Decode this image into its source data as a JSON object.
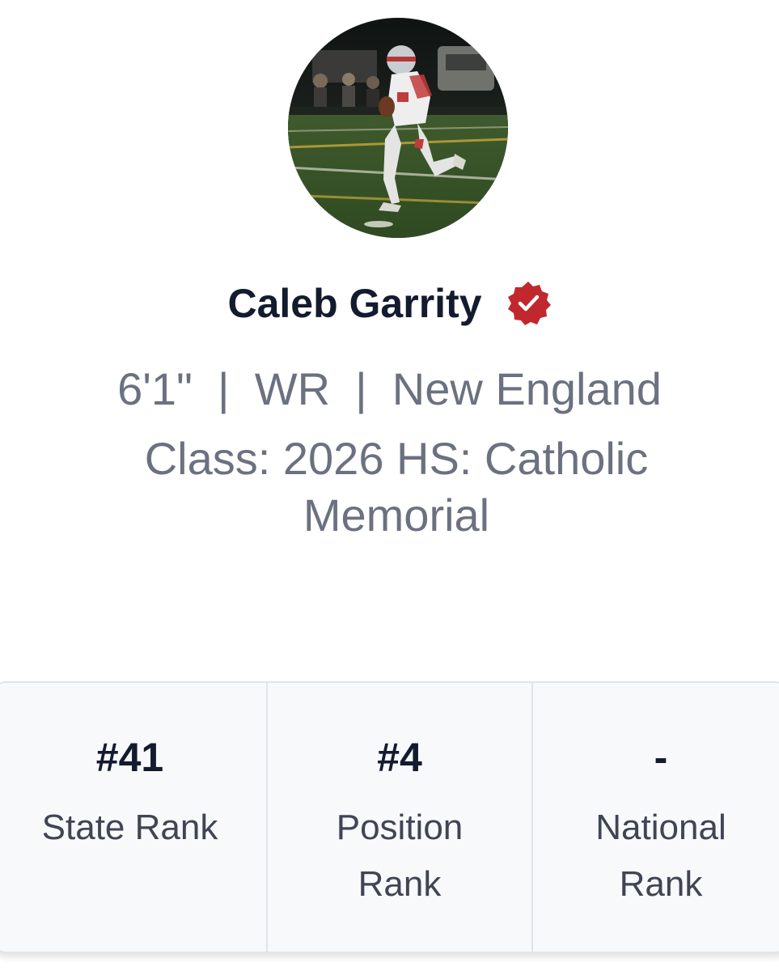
{
  "profile": {
    "name": "Caleb Garrity",
    "meta_line": "6'1\"  |  WR  |  New England",
    "school_line": "Class: 2026 HS: Catholic Memorial",
    "colors": {
      "verified_badge": "#c0282d",
      "name_text": "#131b2e",
      "meta_text": "#6b7180"
    }
  },
  "stats": [
    {
      "value": "#41",
      "label": "State Rank"
    },
    {
      "value": "#4",
      "label": "Position Rank"
    },
    {
      "value": "-",
      "label": "National Rank"
    }
  ]
}
